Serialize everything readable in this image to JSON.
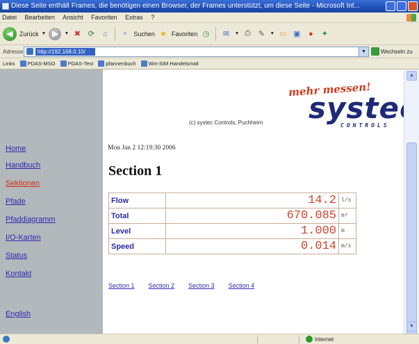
{
  "window": {
    "title": "Diese Seite enthält Frames, die benötigen einen Browser, der Frames unterstützt, um diese Seite - Microsoft Int..."
  },
  "menu": {
    "items": [
      "Datei",
      "Bearbeiten",
      "Ansicht",
      "Favoriten",
      "Extras",
      "?"
    ]
  },
  "toolbar": {
    "back_label": "Zurück",
    "search_label": "Suchen",
    "favorites_label": "Favoriten"
  },
  "addressbar": {
    "label": "Adresse",
    "url": "http://192.168.0.10/",
    "go_label": "Wechseln zu"
  },
  "linksbar": {
    "label": "Links",
    "items": [
      "PDAS-MSO",
      "PDAS-Test",
      "pfannenbuch",
      "Win-SIM Handelsmail"
    ]
  },
  "sidebar": {
    "items": [
      {
        "label": "Home",
        "active": false
      },
      {
        "label": "Handbuch",
        "active": false
      },
      {
        "label": "Sektionen",
        "active": true
      },
      {
        "label": "Pfade",
        "active": false
      },
      {
        "label": "Pfaddiagramm",
        "active": false
      },
      {
        "label": "I/O-Karten",
        "active": false
      },
      {
        "label": "Status",
        "active": false
      },
      {
        "label": "Kontakt",
        "active": false
      },
      {
        "label": "English",
        "active": false
      }
    ]
  },
  "branding": {
    "slogan": "mehr messen!",
    "logo_text": "systec",
    "logo_sub": "CONTROLS",
    "copyright": "(c) systec Controls, Puchheim"
  },
  "main": {
    "date": "Mon Jan 2 12:19:30 2006",
    "section_title": "Section 1",
    "measurements": [
      {
        "label": "Flow",
        "value": "14.2",
        "unit": "l/s"
      },
      {
        "label": "Total",
        "value": "670.085",
        "unit": "m³"
      },
      {
        "label": "Level",
        "value": "1.000",
        "unit": "m"
      },
      {
        "label": "Speed",
        "value": "0.014",
        "unit": "m/s"
      }
    ],
    "section_links": [
      "Section 1",
      "Section 2",
      "Section 3",
      "Section 4"
    ]
  },
  "statusbar": {
    "zone": "Internet"
  },
  "colors": {
    "accent": "#d0432e",
    "link": "#2a2ab0",
    "logo_blue": "#1e2a78",
    "sidebar_bg": "#b3b8bc"
  }
}
